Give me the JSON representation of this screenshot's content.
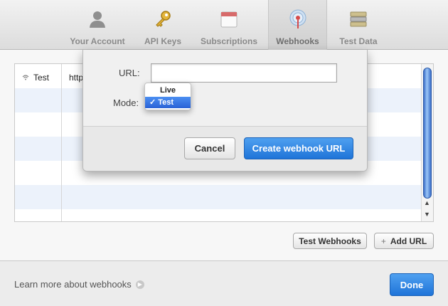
{
  "toolbar": {
    "tabs": [
      {
        "label": "Your Account",
        "icon": "person-icon"
      },
      {
        "label": "API Keys",
        "icon": "key-icon"
      },
      {
        "label": "Subscriptions",
        "icon": "calendar-icon"
      },
      {
        "label": "Webhooks",
        "icon": "broadcast-icon",
        "active": true
      },
      {
        "label": "Test Data",
        "icon": "database-icon"
      }
    ]
  },
  "table": {
    "rows": [
      {
        "mode": "Test",
        "url": "http"
      }
    ]
  },
  "actions": {
    "test_webhooks": "Test Webhooks",
    "add_url": "Add URL"
  },
  "footer": {
    "learn_more": "Learn more about webhooks",
    "done": "Done"
  },
  "dialog": {
    "url_label": "URL:",
    "url_value": "",
    "mode_label": "Mode:",
    "mode_options": [
      "Live",
      "Test"
    ],
    "mode_selected": "Test",
    "cancel": "Cancel",
    "create": "Create webhook URL"
  },
  "colors": {
    "accent": "#2a7ae2",
    "row_alt": "#ecf2fb"
  }
}
